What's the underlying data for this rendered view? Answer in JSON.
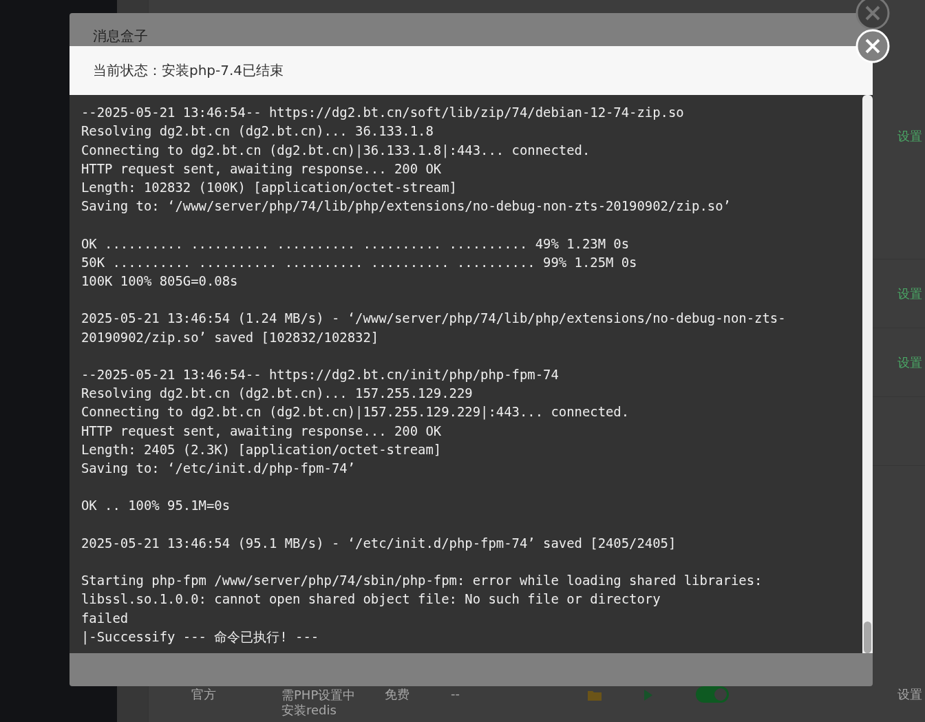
{
  "background_page": {
    "setting_links": [
      "设置",
      "设置",
      "设置"
    ],
    "bottom_row": {
      "source": "官方",
      "description": "需PHP设置中安装redis",
      "price": "免费",
      "expires": "--",
      "toggle_on": true,
      "setting": "设置"
    }
  },
  "message_box": {
    "title": "消息盒子"
  },
  "install_dialog": {
    "status": "当前状态：安装php-7.4已结束",
    "log": [
      [
        "--2025-05-21 13:46:54-- https://dg2.bt.cn/soft/lib/zip/74/debian-12-74-zip.so",
        "Resolving dg2.bt.cn (dg2.bt.cn)... 36.133.1.8",
        "Connecting to dg2.bt.cn (dg2.bt.cn)|36.133.1.8|:443... connected.",
        "HTTP request sent, awaiting response... 200 OK",
        "Length: 102832 (100K) [application/octet-stream]",
        "Saving to: ‘/www/server/php/74/lib/php/extensions/no-debug-non-zts-20190902/zip.so’"
      ],
      [
        "OK .......... .......... .......... .......... .......... 49% 1.23M 0s",
        "50K .......... .......... .......... .......... .......... 99% 1.25M 0s",
        "100K 100% 805G=0.08s"
      ],
      [
        "2025-05-21 13:46:54 (1.24 MB/s) - ‘/www/server/php/74/lib/php/extensions/no-debug-non-zts-20190902/zip.so’ saved [102832/102832]"
      ],
      [
        "--2025-05-21 13:46:54-- https://dg2.bt.cn/init/php/php-fpm-74",
        "Resolving dg2.bt.cn (dg2.bt.cn)... 157.255.129.229",
        "Connecting to dg2.bt.cn (dg2.bt.cn)|157.255.129.229|:443... connected.",
        "HTTP request sent, awaiting response... 200 OK",
        "Length: 2405 (2.3K) [application/octet-stream]",
        "Saving to: ‘/etc/init.d/php-fpm-74’"
      ],
      [
        "OK .. 100% 95.1M=0s"
      ],
      [
        "2025-05-21 13:46:54 (95.1 MB/s) - ‘/etc/init.d/php-fpm-74’ saved [2405/2405]"
      ],
      [
        "Starting php-fpm /www/server/php/74/sbin/php-fpm: error while loading shared libraries:",
        "libssl.so.1.0.0: cannot open shared object file: No such file or directory",
        "failed",
        "|-Successify --- 命令已执行! ---"
      ]
    ]
  }
}
